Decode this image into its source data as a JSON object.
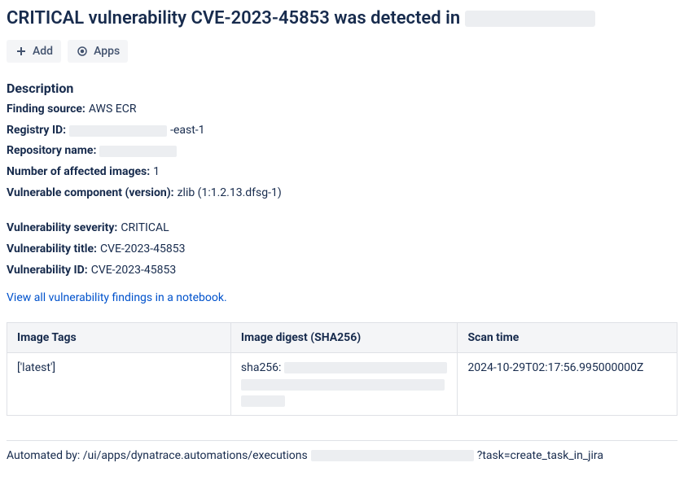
{
  "title_prefix": "CRITICAL vulnerability CVE-2023-45853 was detected in",
  "toolbar": {
    "add_label": "Add",
    "apps_label": "Apps"
  },
  "description": {
    "heading": "Description",
    "finding_source": {
      "label": "Finding source:",
      "value": "AWS ECR"
    },
    "registry_id": {
      "label": "Registry ID:",
      "suffix": "-east-1"
    },
    "repository_name": {
      "label": "Repository name:"
    },
    "affected_images": {
      "label": "Number of affected images:",
      "value": "1"
    },
    "vulnerable_component": {
      "label": "Vulnerable component (version):",
      "value": "zlib (1:1.2.13.dfsg-1)"
    },
    "severity": {
      "label": "Vulnerability severity:",
      "value": "CRITICAL"
    },
    "vuln_title": {
      "label": "Vulnerability title:",
      "value": "CVE-2023-45853"
    },
    "vuln_id": {
      "label": "Vulnerability ID:",
      "value": "CVE-2023-45853"
    }
  },
  "link_view_findings": "View all vulnerability findings in a notebook.",
  "table": {
    "headers": {
      "tags": "Image Tags",
      "digest": "Image digest (SHA256)",
      "scan_time": "Scan time"
    },
    "row": {
      "tags": "['latest']",
      "digest_prefix": "sha256:",
      "scan_time": "2024-10-29T02:17:56.995000000Z"
    }
  },
  "footer": {
    "prefix": "Automated by: /ui/apps/dynatrace.automations/executions",
    "suffix": "?task=create_task_in_jira"
  }
}
